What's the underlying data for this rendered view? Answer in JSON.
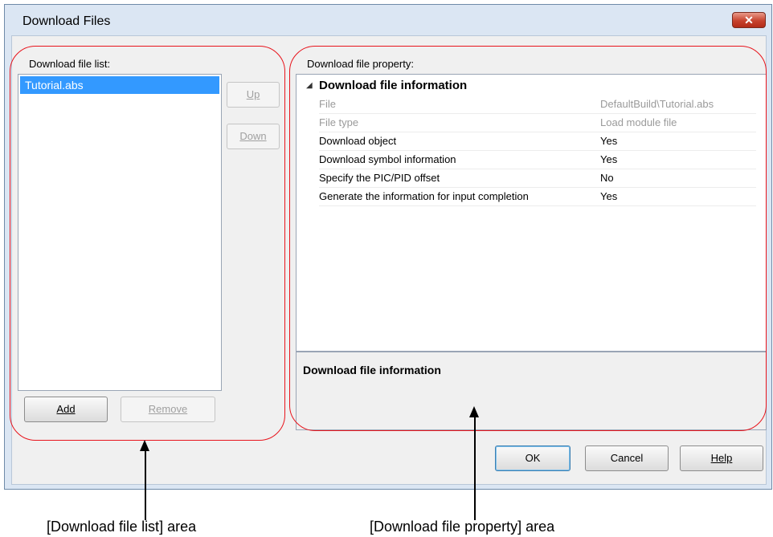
{
  "dialog": {
    "title": "Download Files",
    "close_label": "✕"
  },
  "file_list": {
    "label": "Download file list:",
    "items": [
      "Tutorial.abs"
    ],
    "up_label": "Up",
    "down_label": "Down",
    "add_label": "Add",
    "remove_label": "Remove"
  },
  "property": {
    "label": "Download file property:",
    "category": "Download file information",
    "rows": [
      {
        "name": "File",
        "value": "DefaultBuild\\Tutorial.abs",
        "readonly": true
      },
      {
        "name": "File type",
        "value": "Load module file",
        "readonly": true
      },
      {
        "name": "Download object",
        "value": "Yes",
        "readonly": false
      },
      {
        "name": "Download symbol information",
        "value": "Yes",
        "readonly": false
      },
      {
        "name": "Specify the PIC/PID offset",
        "value": "No",
        "readonly": false
      },
      {
        "name": "Generate the information for input completion",
        "value": "Yes",
        "readonly": false
      }
    ],
    "description_title": "Download file information"
  },
  "footer": {
    "ok_label": "OK",
    "cancel_label": "Cancel",
    "help_label": "Help"
  },
  "annotations": {
    "list_caption": "[Download file list] area",
    "property_caption": "[Download file property] area",
    "highlight_color": "#e8141c"
  }
}
